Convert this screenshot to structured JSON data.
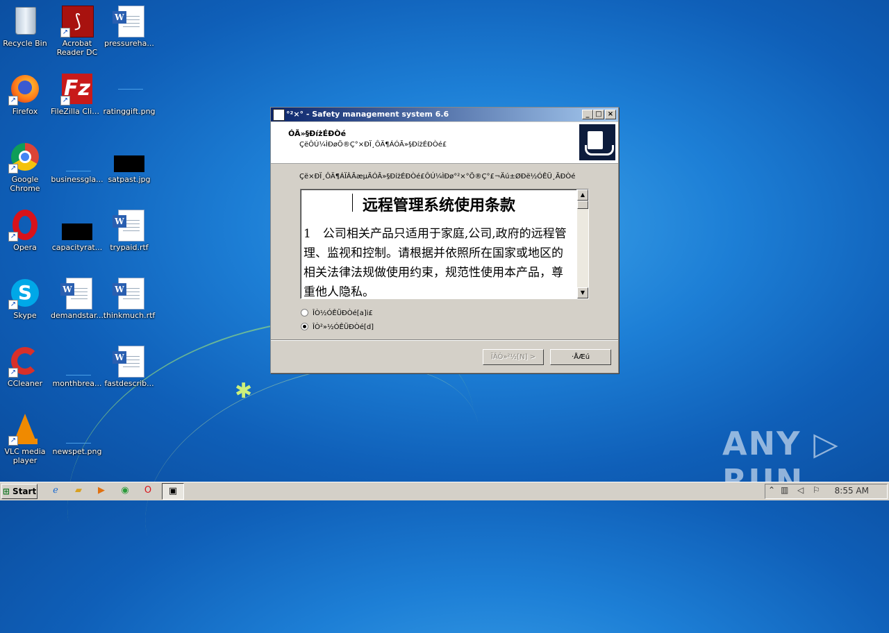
{
  "desktop": {
    "icons": [
      {
        "label": "Recycle Bin"
      },
      {
        "label": "Acrobat Reader DC"
      },
      {
        "label": "pressureha..."
      },
      {
        "label": "Firefox"
      },
      {
        "label": "FileZilla Client"
      },
      {
        "label": "ratinggift.png"
      },
      {
        "label": "Google Chrome"
      },
      {
        "label": "businessgla..."
      },
      {
        "label": "satpast.jpg"
      },
      {
        "label": "Opera"
      },
      {
        "label": "capacityrat..."
      },
      {
        "label": "trypaid.rtf"
      },
      {
        "label": "Skype"
      },
      {
        "label": "demandstar..."
      },
      {
        "label": "thinkmuch.rtf"
      },
      {
        "label": "CCleaner"
      },
      {
        "label": "monthbrea..."
      },
      {
        "label": "fastdescrib..."
      },
      {
        "label": "VLC media player"
      },
      {
        "label": "newspet.png"
      }
    ],
    "watermark": "ANY ▷ RUN"
  },
  "dialog": {
    "title": "°²×° - Safety management system 6.6",
    "header_title": "ÓÃ»§ĐíżÉĐ­Òé",
    "header_subtitle": "ÇëÔÚ¼ÌĐøÖ®Ç°×ĐÏ¸ÔÄ¶ÁÓÃ»§ĐíżÉĐ­Òé£",
    "prompt": "Çë×ĐÏ¸ÔÄ¶ÁÏÂÃæµÄÓÃ»§ĐíżÉĐ­Òé£ÔÚ¼ÌĐø°²×°Ö®Ç°£¬Äú±ØĐë½ÓÊÜ¸ÃĐ­Òé",
    "license_title": "远程管理系统使用条款",
    "license_body": "1　公司相关产品只适用于家庭,公司,政府的远程管理、监视和控制。请根据并依照所在国家或地区的相关法律法规做使用约束，规范性使用本产品，尊重他人隐私。",
    "radio_accept": "ÎÒ½ÓÊÜĐ­Òé[a]i£",
    "radio_decline": "ÎÒ²»½ÓÊÜĐ­Òé[d]",
    "selected": "decline",
    "btn_next": "ÏÂÒ»²½[N] >",
    "btn_cancel": "·ÅÆú",
    "scroll_up": "▲",
    "scroll_down": "▼",
    "minimize": "_",
    "maximize": "□",
    "close": "×"
  },
  "taskbar": {
    "start_label": "Start",
    "clock": "8:55 AM"
  }
}
